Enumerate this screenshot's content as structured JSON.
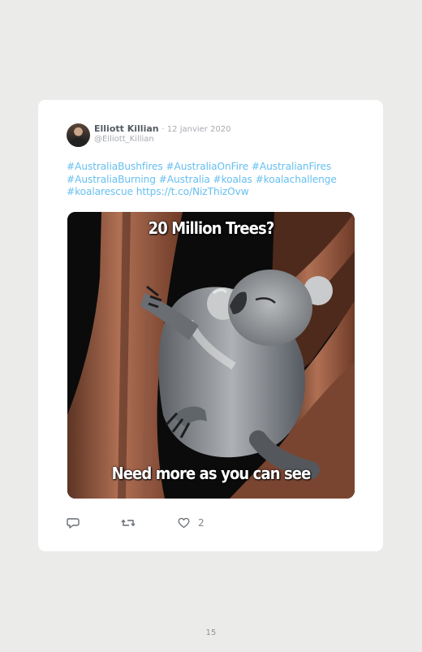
{
  "tweet": {
    "author_name": "Elliott Killian",
    "meta": "· 12 janvier 2020",
    "handle": "@Elliott_Killian",
    "text_lines": [
      "#AustraliaBushfires #AustraliaOnFire #AustralianFires",
      "#AustraliaBurning #Australia #koalas #koalachallenge",
      "#koalarescue https://t.co/NizThizOvw"
    ],
    "media": {
      "top_caption": "20 Million Trees?",
      "bottom_caption": "Need more as you can see",
      "subject": "koala-on-tree"
    },
    "actions": {
      "reply_icon": "reply-icon",
      "retweet_icon": "retweet-icon",
      "like_icon": "heart-icon",
      "like_count": "2"
    }
  },
  "page": {
    "number": "15"
  },
  "colors": {
    "background": "#ebebea",
    "card": "#ffffff",
    "link": "#66bff0",
    "name": "#555b63",
    "muted": "#a7aab0"
  }
}
